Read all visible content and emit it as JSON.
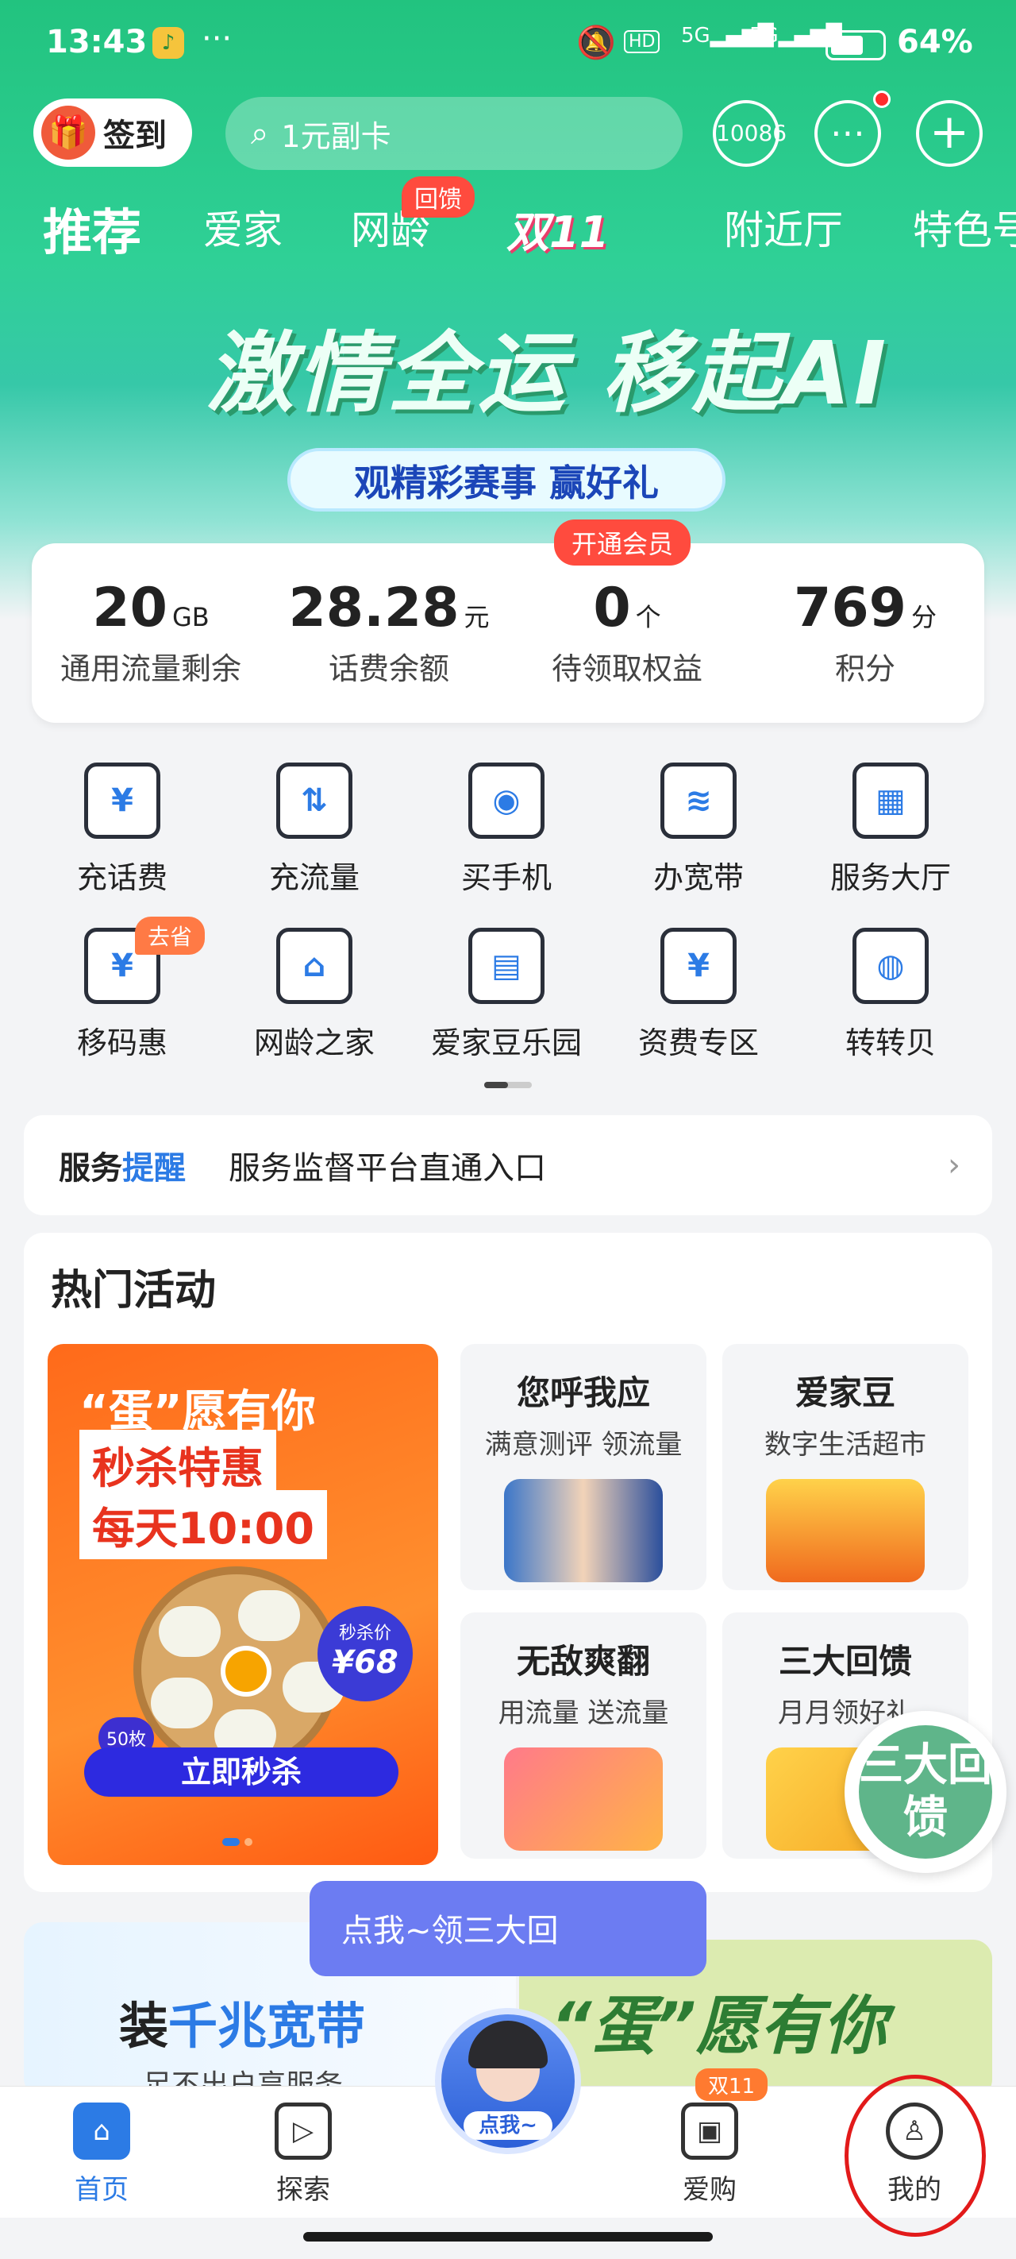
{
  "status_bar": {
    "time": "13:43",
    "battery": "64%",
    "hd": "HD",
    "signal1": "5G",
    "signal2": "5G"
  },
  "header": {
    "sign_in": "签到",
    "search_placeholder": "1元副卡",
    "service_number": "10086"
  },
  "tabs": {
    "items": [
      "推荐",
      "爱家",
      "网龄",
      "双11",
      "附近厅",
      "特色号"
    ],
    "active": "推荐",
    "badge": "回馈"
  },
  "banner": {
    "title": "激情全运 移起AI",
    "subtitle": "观精彩赛事 赢好礼"
  },
  "summary": {
    "vip_badge": "开通会员",
    "items": [
      {
        "value": "20",
        "unit": "GB",
        "label": "通用流量剩余"
      },
      {
        "value": "28.28",
        "unit": "元",
        "label": "话费余额"
      },
      {
        "value": "0",
        "unit": "个",
        "label": "待领取权益"
      },
      {
        "value": "769",
        "unit": "分",
        "label": "积分"
      }
    ]
  },
  "grid": {
    "row1": [
      {
        "label": "充话费",
        "icon": "¥"
      },
      {
        "label": "充流量",
        "icon": "⇅"
      },
      {
        "label": "买手机",
        "icon": "◉"
      },
      {
        "label": "办宽带",
        "icon": "≋"
      },
      {
        "label": "服务大厅",
        "icon": "▦"
      }
    ],
    "row2": [
      {
        "label": "移码惠",
        "icon": "¥"
      },
      {
        "label": "网龄之家",
        "icon": "⌂"
      },
      {
        "label": "爱家豆乐园",
        "icon": "▤"
      },
      {
        "label": "资费专区",
        "icon": "¥"
      },
      {
        "label": "转转贝",
        "icon": "◍"
      }
    ],
    "save_badge": "去省"
  },
  "notice": {
    "tag_a": "服务",
    "tag_b": "提醒",
    "text": "服务监督平台直通入口",
    "chevron": "›"
  },
  "hot": {
    "title": "热门活动",
    "promo": {
      "line1": "“蛋”愿有你",
      "line2": "秒杀特惠",
      "line3": "每天10:00",
      "price_label": "秒杀价",
      "price": "¥68",
      "count": "50枚",
      "button": "立即秒杀"
    },
    "tiles": [
      {
        "title": "您呼我应",
        "sub": "满意测评 领流量"
      },
      {
        "title": "爱家豆",
        "sub": "数字生活超市"
      },
      {
        "title": "无敌爽翻",
        "sub": "用流量 送流量"
      },
      {
        "title": "三大回馈",
        "sub": "月月领好礼"
      }
    ],
    "float": "三大回馈"
  },
  "bottom_promos": {
    "broadband_prefix": "装",
    "broadband_highlight": "千兆宽带",
    "broadband_sub": "足不出户享服务",
    "egg": "“蛋”愿有你"
  },
  "assistant": {
    "tip": "点我~领三大回",
    "cap": "点我~"
  },
  "nav": {
    "items": [
      {
        "label": "首页",
        "icon": "⌂"
      },
      {
        "label": "探索",
        "icon": "▷"
      },
      {
        "label": "爱购",
        "icon": "▣"
      },
      {
        "label": "我的",
        "icon": "♙"
      }
    ],
    "d11_badge": "双11"
  },
  "colors": {
    "brand": "#22c37f",
    "accent": "#2c7be5",
    "alert": "#ff4b3e",
    "highlight_circle": "#e21a1a"
  }
}
